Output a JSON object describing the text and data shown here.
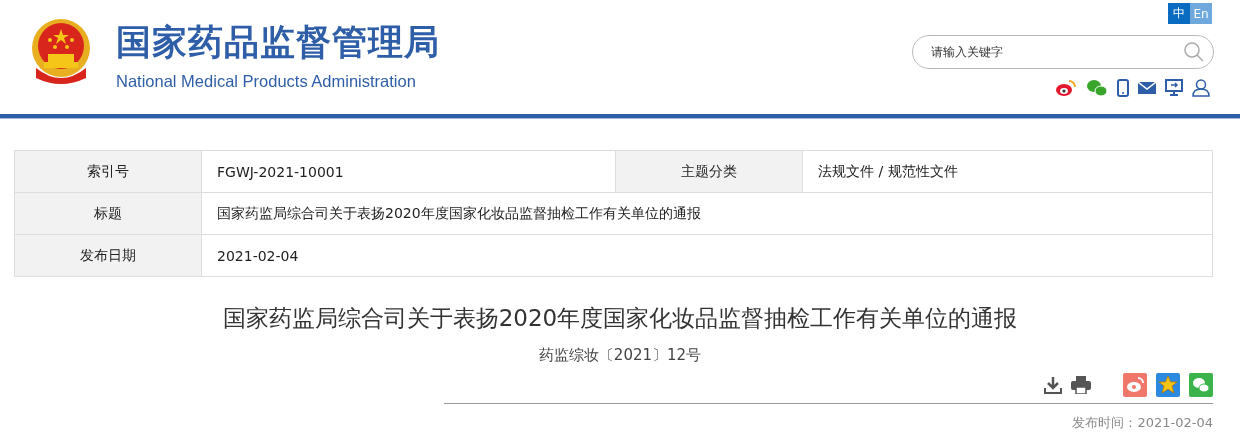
{
  "header": {
    "title": "国家药品监督管理局",
    "subtitle": "National Medical Products Administration",
    "languages": [
      {
        "label": "中",
        "selected": true
      },
      {
        "label": "En",
        "selected": false
      }
    ],
    "search": {
      "placeholder": "请输入关键字"
    }
  },
  "info_table": {
    "rows": [
      {
        "cells": [
          {
            "label": "索引号",
            "value": "FGWJ-2021-10001"
          },
          {
            "label": "主题分类",
            "value": "法规文件 / 规范性文件"
          }
        ]
      },
      {
        "cells": [
          {
            "label": "标题",
            "value": "国家药监局综合司关于表扬2020年度国家化妆品监督抽检工作有关单位的通报"
          }
        ]
      },
      {
        "cells": [
          {
            "label": "发布日期",
            "value": "2021-02-04"
          }
        ]
      }
    ]
  },
  "article": {
    "title": "国家药监局综合司关于表扬2020年度国家化妆品监督抽检工作有关单位的通报",
    "doc_number": "药监综妆〔2021〕12号",
    "publish_time": "发布时间：2021-02-04"
  }
}
